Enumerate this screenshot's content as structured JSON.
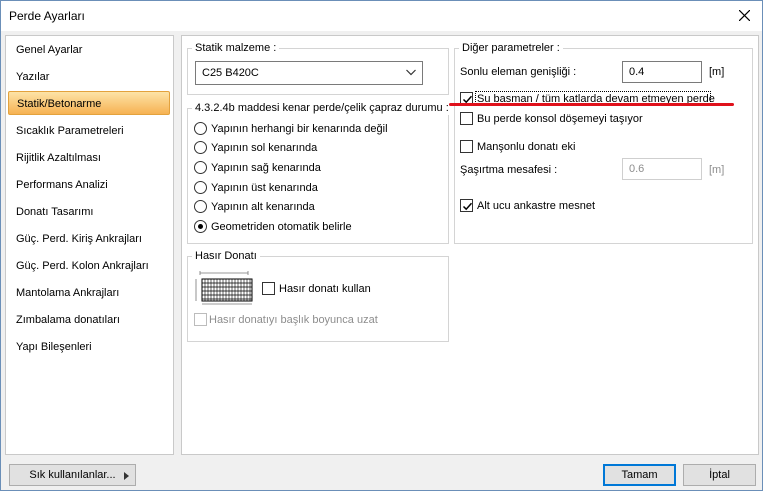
{
  "window": {
    "title": "Perde Ayarları"
  },
  "sidebar": {
    "items": [
      {
        "label": "Genel Ayarlar"
      },
      {
        "label": "Yazılar"
      },
      {
        "label": "Statik/Betonarme",
        "active": true
      },
      {
        "label": "Sıcaklık Parametreleri"
      },
      {
        "label": "Rijitlik Azaltılması"
      },
      {
        "label": "Performans Analizi"
      },
      {
        "label": "Donatı Tasarımı"
      },
      {
        "label": "Güç. Perd. Kiriş Ankrajları"
      },
      {
        "label": "Güç. Perd. Kolon Ankrajları"
      },
      {
        "label": "Mantolama Ankrajları"
      },
      {
        "label": "Zımbalama donatıları"
      },
      {
        "label": "Yapı Bileşenleri"
      }
    ]
  },
  "material": {
    "group_title": "Statik malzeme :",
    "selected": "C25 B420C"
  },
  "edge_condition": {
    "group_title": "4.3.2.4b maddesi kenar perde/çelik çapraz durumu :",
    "options": [
      "Yapının herhangi bir kenarında değil",
      "Yapının sol kenarında",
      "Yapının sağ kenarında",
      "Yapının üst kenarında",
      "Yapının alt kenarında",
      "Geometriden otomatik belirle"
    ],
    "selected_index": 5
  },
  "hasir": {
    "group_title": "Hasır Donatı",
    "use_label": "Hasır donatı kullan",
    "use_checked": false,
    "extend_label": "Hasır donatıyı başlık boyunca uzat",
    "extend_checked": false,
    "icon": "mesh-icon"
  },
  "other": {
    "group_title": "Diğer parametreler :",
    "element_width_label": "Sonlu eleman genişliği :",
    "element_width_value": "0.4",
    "element_width_unit": "[m]",
    "basement_label": "Su basman / tüm katlarda devam etmeyen perde",
    "basement_checked": true,
    "cantilever_label": "Bu perde konsol döşemeyi taşıyor",
    "cantilever_checked": false,
    "sleeve_label": "Manşonlu donatı eki",
    "sleeve_checked": false,
    "stagger_label": "Şaşırtma mesafesi :",
    "stagger_value": "0.6",
    "stagger_unit": "[m]",
    "fixed_base_label": "Alt ucu ankastre mesnet",
    "fixed_base_checked": true
  },
  "footer": {
    "favorites_label": "Sık kullanılanlar...",
    "ok_label": "Tamam",
    "cancel_label": "İptal"
  },
  "colors": {
    "active_item_top": "#fde3a7",
    "active_item_bottom": "#f6b253",
    "annotation_line": "#e0111b",
    "default_button_border": "#0078d7"
  }
}
